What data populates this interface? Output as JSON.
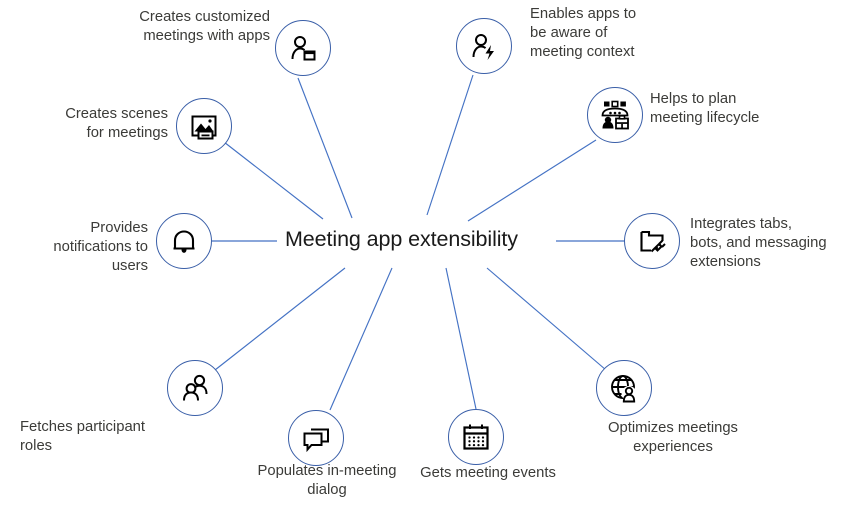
{
  "diagram": {
    "type": "hub-and-spoke",
    "hub": {
      "title": "Meeting app extensibility"
    },
    "accent_color": "#3a5fa8",
    "icon_color": "#000000",
    "label_color": "#3b3b38",
    "background_color": "#ffffff",
    "nodes": [
      {
        "id": "creates-scenes",
        "icon": "image-picture-icon",
        "label": "Creates scenes\nfor meetings"
      },
      {
        "id": "creates-customized-meetings",
        "icon": "person-with-app-card-icon",
        "label": "Creates customized\nmeetings with apps"
      },
      {
        "id": "meeting-context",
        "icon": "person-with-lightning-bolt-icon",
        "label": "Enables apps to\nbe aware of\nmeeting context"
      },
      {
        "id": "meeting-lifecycle",
        "icon": "meeting-room-presentation-icon",
        "label": "Helps to plan\nmeeting lifecycle"
      },
      {
        "id": "integrates-extensions",
        "icon": "tab-with-plug-icon",
        "label": "Integrates tabs,\nbots, and messaging\nextensions"
      },
      {
        "id": "optimizes-experiences",
        "icon": "globe-with-person-icon",
        "label": "Optimizes meetings\nexperiences"
      },
      {
        "id": "meeting-events",
        "icon": "calendar-icon",
        "label": "Gets meeting events"
      },
      {
        "id": "in-meeting-dialog",
        "icon": "chat-bubbles-icon",
        "label": "Populates in-meeting\ndialog"
      },
      {
        "id": "participant-roles",
        "icon": "two-people-icon",
        "label": "Fetches participant\nroles"
      },
      {
        "id": "notifications",
        "icon": "bell-icon",
        "label": "Provides\nnotifications to\nusers"
      }
    ]
  }
}
